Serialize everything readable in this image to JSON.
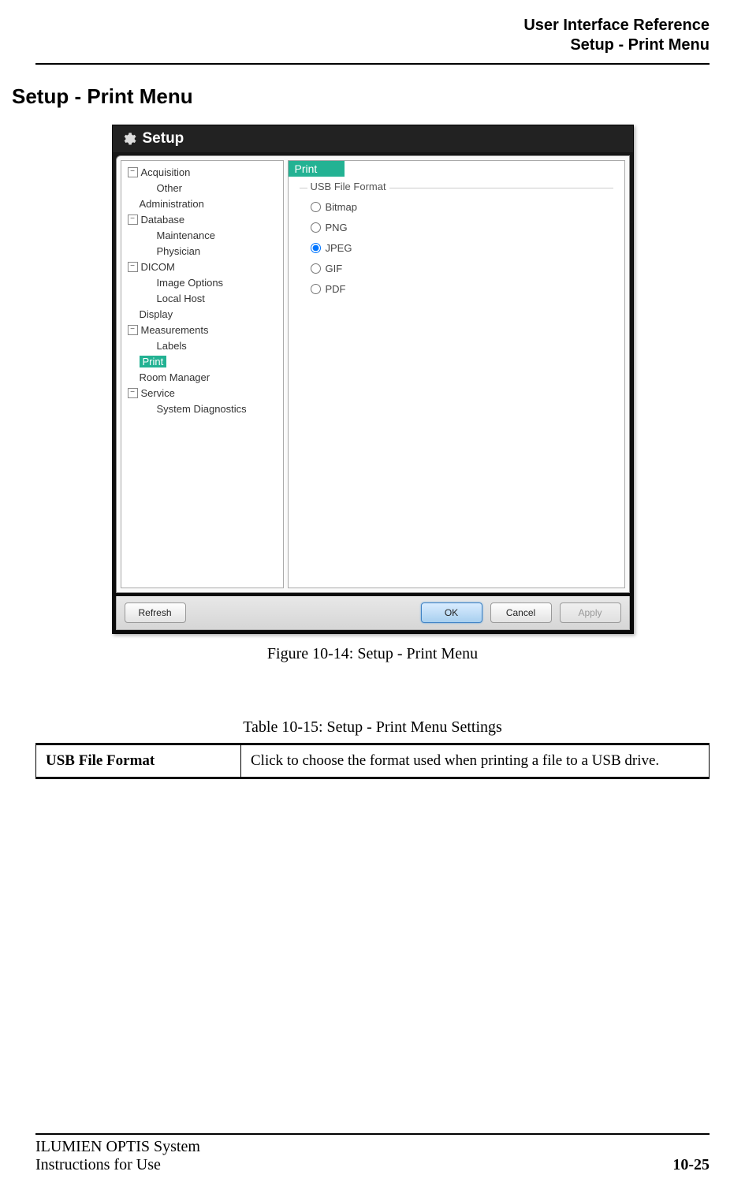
{
  "header": {
    "line1": "User Interface Reference",
    "line2": "Setup - Print Menu"
  },
  "section_title": "Setup - Print Menu",
  "setup": {
    "window_title": "Setup",
    "tree": {
      "acquisition": "Acquisition",
      "other": "Other",
      "administration": "Administration",
      "database": "Database",
      "maintenance": "Maintenance",
      "physician": "Physician",
      "dicom": "DICOM",
      "image_options": "Image Options",
      "local_host": "Local Host",
      "display": "Display",
      "measurements": "Measurements",
      "labels": "Labels",
      "print": "Print",
      "room_manager": "Room Manager",
      "service": "Service",
      "system_diagnostics": "System Diagnostics"
    },
    "panel": {
      "title": "Print",
      "group_label": "USB File Format",
      "options": {
        "bitmap": "Bitmap",
        "png": "PNG",
        "jpeg": "JPEG",
        "gif": "GIF",
        "pdf": "PDF"
      }
    },
    "buttons": {
      "refresh": "Refresh",
      "ok": "OK",
      "cancel": "Cancel",
      "apply": "Apply"
    }
  },
  "figure_caption": "Figure 10-14:  Setup - Print Menu",
  "table_caption": "Table 10-15:  Setup - Print Menu Settings",
  "table": {
    "key": "USB File Format",
    "value": "Click to choose the format used when printing a file to a USB drive."
  },
  "footer": {
    "system_line1": "ILUMIEN OPTIS System",
    "system_line2": "Instructions for Use",
    "page": "10-25"
  }
}
